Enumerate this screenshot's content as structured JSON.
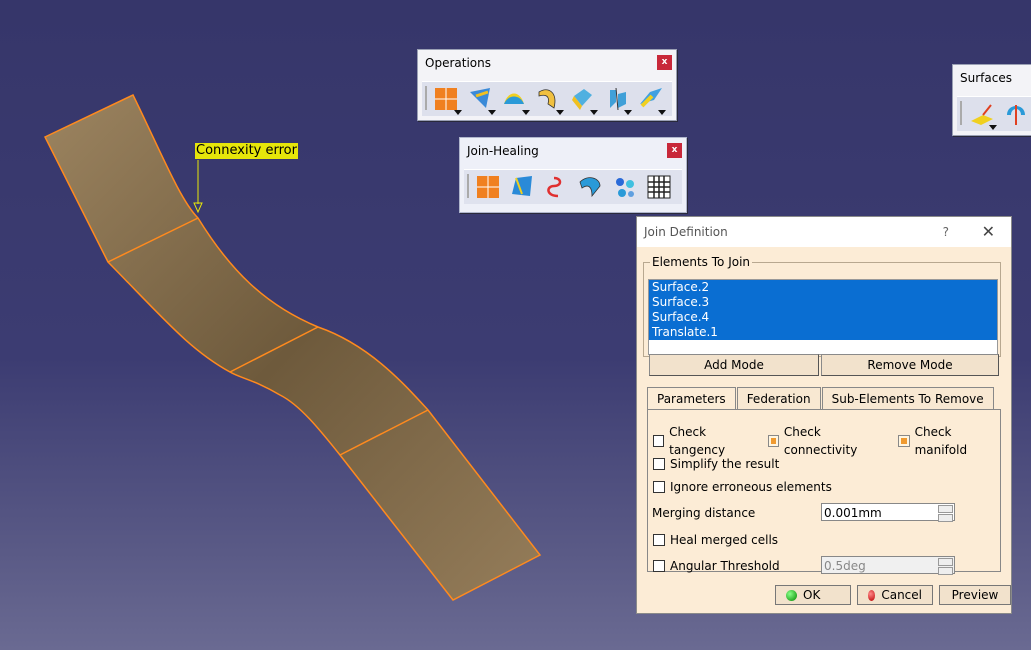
{
  "viewport": {
    "annotation": "Connexity error"
  },
  "operations_toolbar": {
    "title": "Operations",
    "close": "x",
    "icons": [
      "join-icon",
      "healing-icon",
      "curve-smooth-icon",
      "untrim-icon",
      "disassemble-icon",
      "split-icon",
      "trim-icon"
    ]
  },
  "joinhealing_toolbar": {
    "title": "Join-Healing",
    "close": "x",
    "icons": [
      "join-icon",
      "healing-icon",
      "curve-smooth-icon",
      "untrim-icon",
      "disassemble-icon",
      "grid-icon"
    ]
  },
  "surfaces_toolbar": {
    "title": "Surfaces",
    "icons": [
      "extrude-icon",
      "revolve-icon"
    ]
  },
  "dialog": {
    "title": "Join Definition",
    "help": "?",
    "close": "✕",
    "group_label": "Elements To Join",
    "elements": [
      "Surface.2",
      "Surface.3",
      "Surface.4",
      "Translate.1"
    ],
    "add_mode": "Add Mode",
    "remove_mode": "Remove Mode",
    "tabs": [
      "Parameters",
      "Federation",
      "Sub-Elements To Remove"
    ],
    "check_tangency": "Check tangency",
    "check_connectivity": "Check connectivity",
    "check_manifold": "Check manifold",
    "simplify": "Simplify the result",
    "ignore": "Ignore erroneous elements",
    "merging_label": "Merging distance",
    "merging_value": "0.001mm",
    "heal": "Heal merged cells",
    "angular_label": "Angular Threshold",
    "angular_value": "0.5deg",
    "ok": "OK",
    "cancel": "Cancel",
    "preview": "Preview"
  }
}
